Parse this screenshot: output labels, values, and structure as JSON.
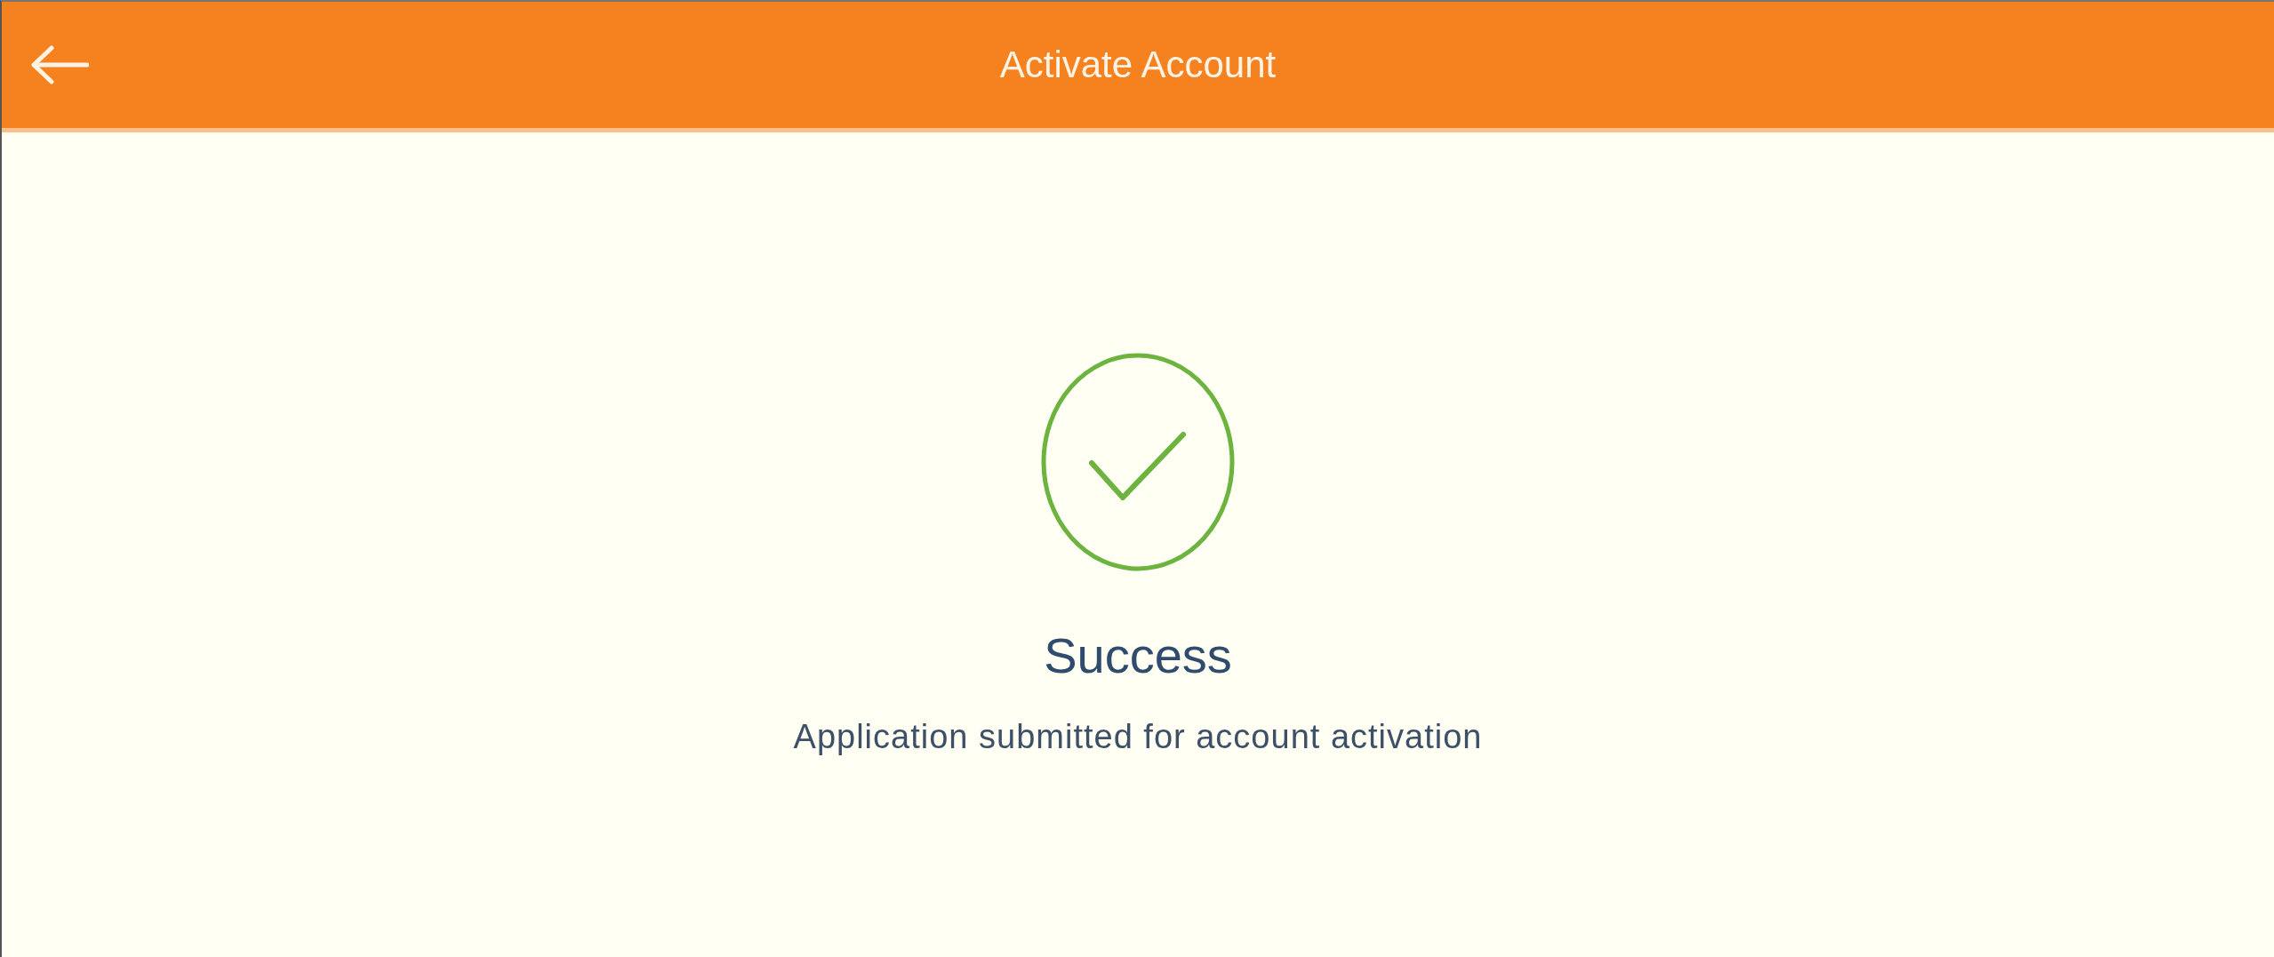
{
  "header": {
    "title": "Activate Account"
  },
  "result": {
    "title": "Success",
    "message": "Application submitted for account activation"
  }
}
